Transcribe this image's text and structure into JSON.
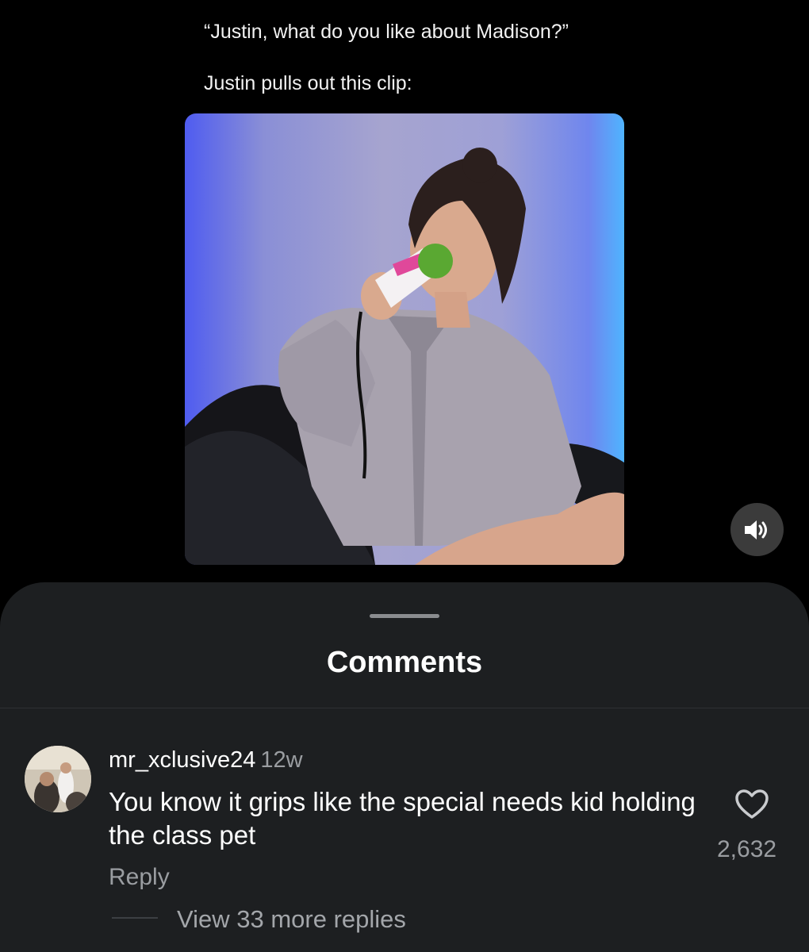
{
  "post": {
    "caption_line1": "“Justin, what do you like about Madison?”",
    "caption_line2": "Justin pulls out this clip:",
    "video": {
      "icon": "speaker-icon"
    }
  },
  "comments_sheet": {
    "title": "Comments",
    "comment": {
      "username": "mr_xclusive24",
      "timestamp": "12w",
      "text": "You know it grips like the special needs kid holding the class pet",
      "like_icon": "heart-outline-icon",
      "likes": "2,632",
      "reply_label": "Reply",
      "view_replies_label": "View 33 more replies"
    }
  }
}
